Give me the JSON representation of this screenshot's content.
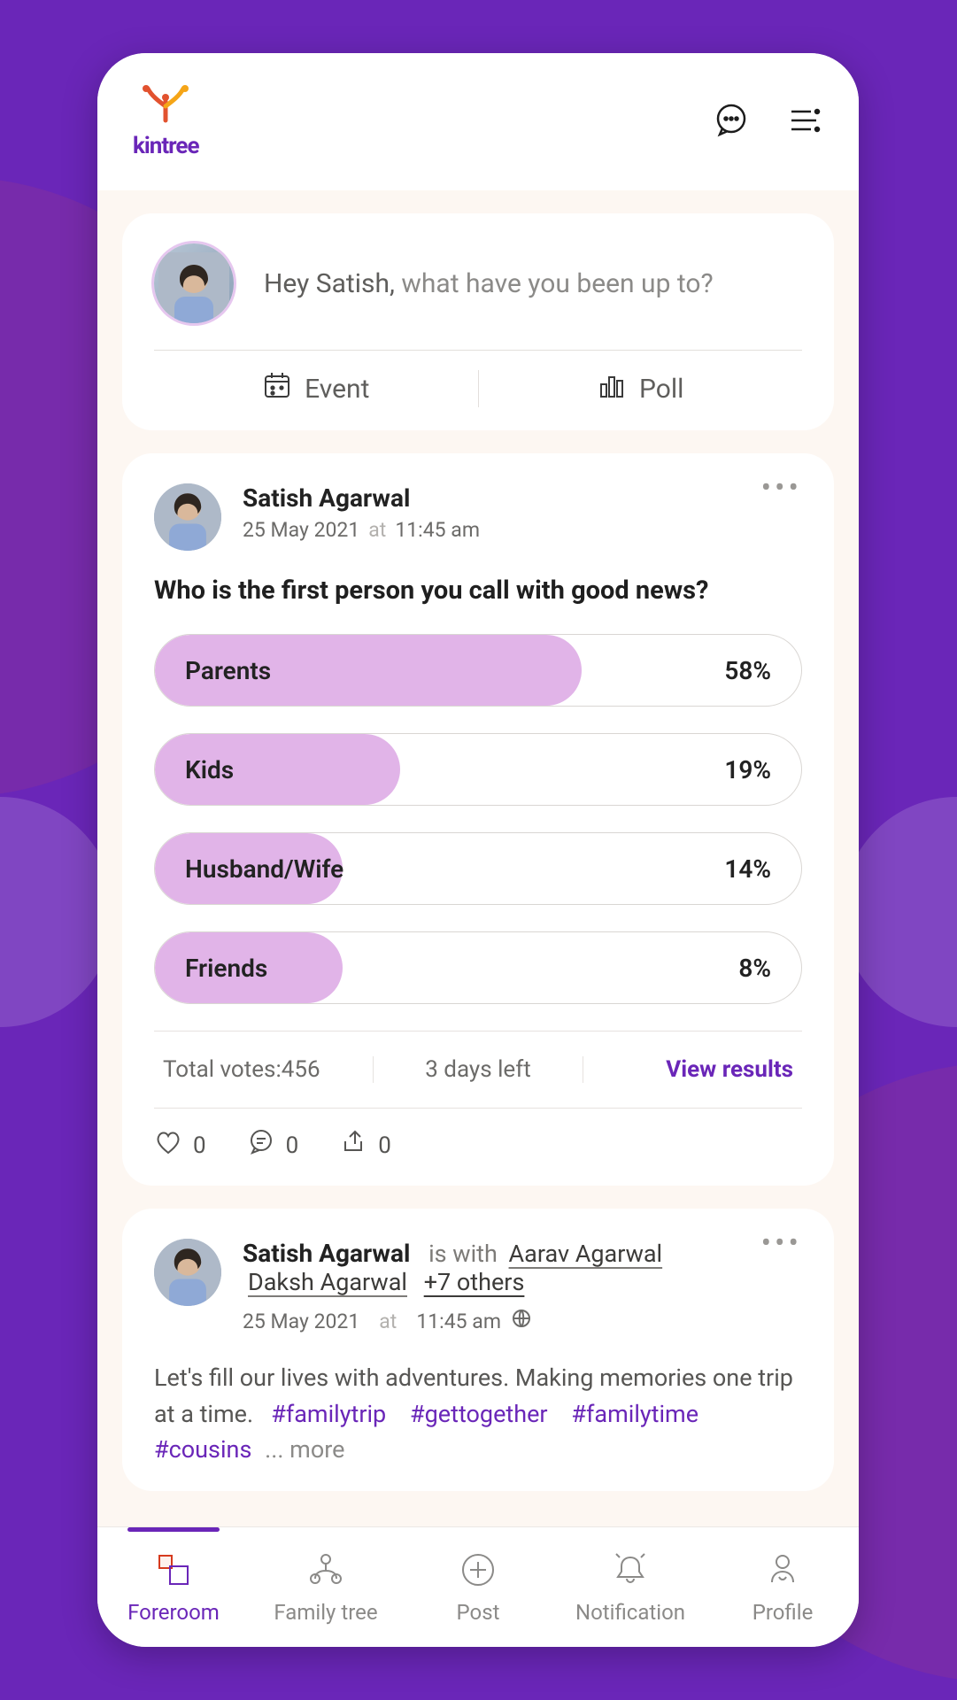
{
  "brand": "kintree",
  "composer": {
    "greeting": "Hey Satish,",
    "prompt": " what have you been up to?",
    "event_label": "Event",
    "poll_label": "Poll"
  },
  "poll_post": {
    "author": "Satish Agarwal",
    "date": "25 May 2021",
    "at": "at",
    "time": "11:45 am",
    "question": "Who is the first person you call with good news?",
    "options": [
      {
        "label": "Parents",
        "pct": "58%",
        "fill": 66
      },
      {
        "label": "Kids",
        "pct": "19%",
        "fill": 38
      },
      {
        "label": "Husband/Wife",
        "pct": "14%",
        "fill": 29
      },
      {
        "label": "Friends",
        "pct": "8%",
        "fill": 29
      }
    ],
    "total_label": "Total votes:",
    "total_value": "456",
    "time_left": "3 days left",
    "view_results": "View results",
    "likes": "0",
    "comments": "0",
    "shares": "0"
  },
  "post2": {
    "author": "Satish Agarwal",
    "is_with": "is with",
    "tag1": "Aarav Agarwal",
    "tag2": "Daksh Agarwal",
    "others": "+7 others",
    "date": "25 May 2021",
    "at": "at",
    "time": "11:45 am",
    "body": "Let's fill our lives with adventures. Making memories one trip at a time.",
    "hashes": [
      "#familytrip",
      "#gettogether",
      "#familytime",
      "#cousins"
    ],
    "more": "... more"
  },
  "nav": {
    "foreroom": "Foreroom",
    "familytree": "Family tree",
    "post": "Post",
    "notification": "Notification",
    "profile": "Profile"
  },
  "colors": {
    "accent": "#6a26b8"
  }
}
